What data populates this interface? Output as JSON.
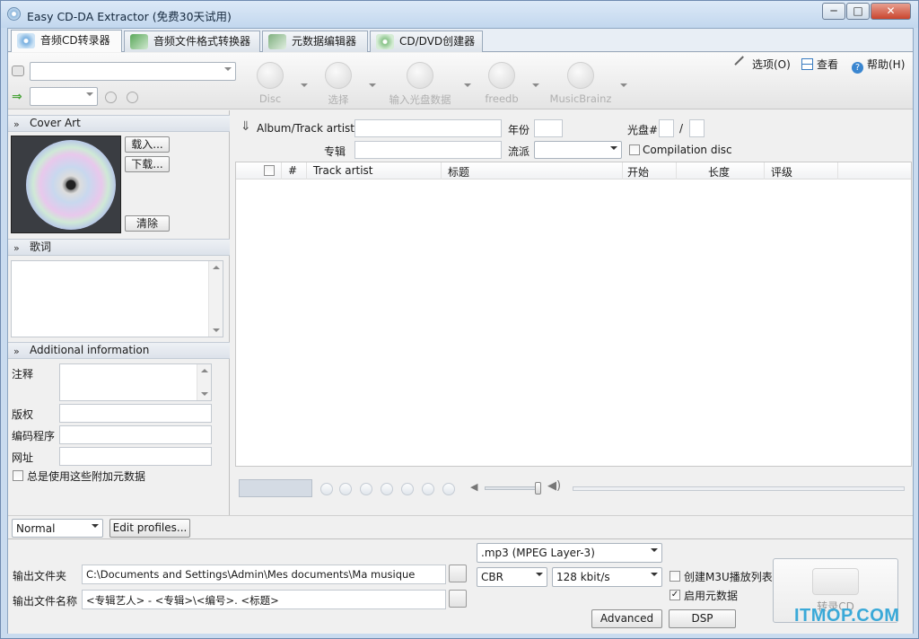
{
  "window": {
    "title": "Easy CD-DA Extractor (免费30天试用)",
    "min": "─",
    "max": "□",
    "close": "✕"
  },
  "tabs": [
    {
      "label": "音频CD转录器"
    },
    {
      "label": "音频文件格式转换器"
    },
    {
      "label": "元数据编辑器"
    },
    {
      "label": "CD/DVD创建器"
    }
  ],
  "toolbar": {
    "buttons": [
      {
        "label": "Disc"
      },
      {
        "label": "选择"
      },
      {
        "label": "输入光盘数据"
      },
      {
        "label": "freedb"
      },
      {
        "label": "MusicBrainz"
      }
    ],
    "options_label": "选项(O)",
    "view_label": "查看",
    "help_label": "帮助(H)"
  },
  "left": {
    "cover_art_header": "Cover Art",
    "load_button": "载入...",
    "download_button": "下载...",
    "clear_button": "清除",
    "lyrics_header": "歌词",
    "additional_header": "Additional information",
    "comment_label": "注释",
    "copyright_label": "版权",
    "encoder_label": "编码程序",
    "url_label": "网址",
    "always_use_label": "总是使用这些附加元数据"
  },
  "metadata": {
    "album_artists_label": "Album/Track artists",
    "year_label": "年份",
    "disc_label": "光盘#",
    "disc_sep": "/",
    "album_label": "专辑",
    "genre_label": "流派",
    "compilation_label": "Compilation disc"
  },
  "grid": {
    "columns": [
      "#",
      "Track artist",
      "标题",
      "开始",
      "长度",
      "评级"
    ]
  },
  "profile": {
    "selected": "Normal",
    "edit_button": "Edit profiles..."
  },
  "output": {
    "folder_label": "输出文件夹",
    "folder_value": "C:\\Documents and Settings\\Admin\\Mes documents\\Ma musique",
    "filename_label": "输出文件名称",
    "filename_value": "<专辑艺人> - <专辑>\\<编号>. <标题>",
    "format_selected": ".mp3 (MPEG Layer-3)",
    "mode_selected": "CBR",
    "bitrate_selected": "128 kbit/s",
    "create_m3u_label": "创建M3U播放列表",
    "enable_metadata_label": "启用元数据",
    "advanced_button": "Advanced",
    "dsp_button": "DSP",
    "rip_button": "转录CD"
  },
  "watermark": "ITMOP.COM"
}
